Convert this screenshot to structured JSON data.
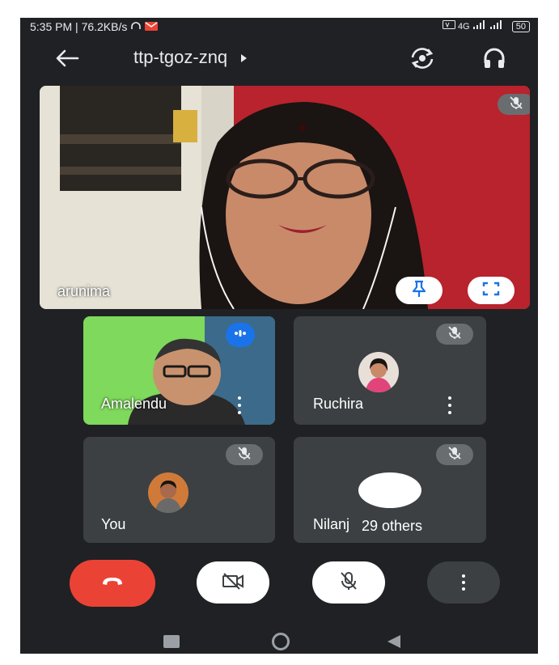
{
  "status_bar": {
    "time": "5:35 PM",
    "speed": "76.2KB/s",
    "network": "4G",
    "battery": "50"
  },
  "top_bar": {
    "meeting_code": "ttp-tgoz-znq"
  },
  "main_tile": {
    "name": "arunima"
  },
  "tiles": [
    {
      "name": "Amalendu"
    },
    {
      "name": "Ruchira"
    },
    {
      "name": "You"
    },
    {
      "name": "Nilanj"
    }
  ],
  "others_chip": {
    "label": "29 others"
  },
  "colors": {
    "background": "#202124",
    "tile": "#3c4043",
    "end_call": "#ea4335",
    "speaking_badge": "#1a73e8"
  },
  "icons": {
    "back": "arrow-left-icon",
    "switch_camera": "switch-camera-icon",
    "audio": "headphones-icon",
    "pin": "pin-icon",
    "fullscreen": "fullscreen-icon",
    "mic_off": "mic-off-icon",
    "camera_off": "camera-off-icon",
    "end_call": "phone-hangup-icon",
    "more": "more-vert-icon"
  }
}
